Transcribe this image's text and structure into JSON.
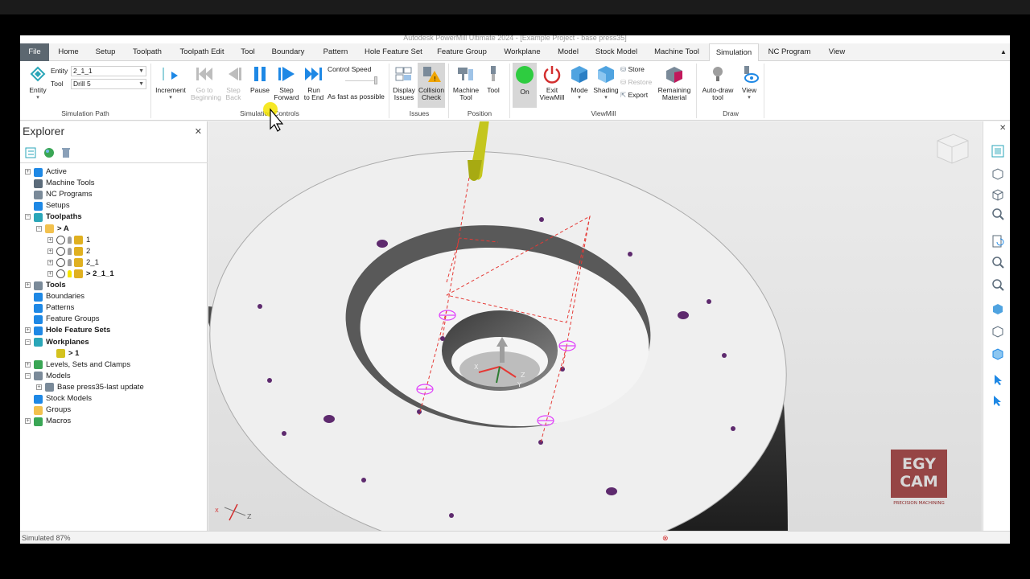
{
  "window": {
    "title": "Autodesk PowerMill Ultimate 2024 - [Example Project - base press35]"
  },
  "tabs": [
    "File",
    "Home",
    "Setup",
    "Toolpath",
    "Toolpath Edit",
    "Tool",
    "Boundary",
    "Pattern",
    "Hole Feature Set",
    "Feature Group",
    "Workplane",
    "Model",
    "Stock Model",
    "Machine Tool",
    "Simulation",
    "NC Program",
    "View"
  ],
  "active_tab": "Simulation",
  "ribbon": {
    "simpath": {
      "entity_btn": "Entity",
      "entity_label": "Entity",
      "entity_value": "2_1_1",
      "tool_label": "Tool",
      "tool_value": "Drill 5",
      "group": "Simulation Path"
    },
    "controls": {
      "increment": "Increment",
      "go_to_beginning_1": "Go to",
      "go_to_beginning_2": "Beginning",
      "step_back_1": "Step",
      "step_back_2": "Back",
      "pause": "Pause",
      "step_forward_1": "Step",
      "step_forward_2": "Forward",
      "run_to_end_1": "Run",
      "run_to_end_2": "to End",
      "control_speed": "Control Speed",
      "fast": "As fast as possible",
      "group": "Simulation Controls"
    },
    "issues": {
      "display_1": "Display",
      "display_2": "Issues",
      "collision_1": "Collision",
      "collision_2": "Check",
      "group": "Issues"
    },
    "position": {
      "machine_1": "Machine",
      "machine_2": "Tool",
      "tool": "Tool",
      "group": "Position"
    },
    "viewmill": {
      "on": "On",
      "exit_1": "Exit",
      "exit_2": "ViewMill",
      "mode": "Mode",
      "shading": "Shading",
      "store": "Store",
      "restore": "Restore",
      "export": "Export",
      "remaining_1": "Remaining",
      "remaining_2": "Material",
      "group": "ViewMill"
    },
    "draw": {
      "auto_1": "Auto-draw",
      "auto_2": "tool",
      "view": "View",
      "group": "Draw"
    }
  },
  "explorer": {
    "title": "Explorer",
    "tree": [
      {
        "label": "Active",
        "bold": false
      },
      {
        "label": "Machine Tools",
        "bold": false
      },
      {
        "label": "NC Programs",
        "bold": false
      },
      {
        "label": "Setups",
        "bold": false
      },
      {
        "label": "Toolpaths",
        "bold": true
      },
      {
        "label": "> A",
        "bold": true
      },
      {
        "label": "1",
        "bold": false
      },
      {
        "label": "2",
        "bold": false
      },
      {
        "label": "2_1",
        "bold": false
      },
      {
        "label": "> 2_1_1",
        "bold": true
      },
      {
        "label": "Tools",
        "bold": true
      },
      {
        "label": "Boundaries",
        "bold": false
      },
      {
        "label": "Patterns",
        "bold": false
      },
      {
        "label": "Feature Groups",
        "bold": false
      },
      {
        "label": "Hole Feature Sets",
        "bold": true
      },
      {
        "label": "Workplanes",
        "bold": true
      },
      {
        "label": "> 1",
        "bold": true
      },
      {
        "label": "Levels, Sets and Clamps",
        "bold": false
      },
      {
        "label": "Models",
        "bold": false
      },
      {
        "label": "Base press35-last update",
        "bold": false
      },
      {
        "label": "Stock Models",
        "bold": false
      },
      {
        "label": "Groups",
        "bold": false
      },
      {
        "label": "Macros",
        "bold": false
      }
    ]
  },
  "viewport": {
    "axis_labels": {
      "x": "X",
      "y": "Y",
      "z": "Z"
    },
    "watermark_1": "EGY",
    "watermark_2": "CAM",
    "watermark_3": "PRECISION MACHINING"
  },
  "status": {
    "text": "Simulated 87%"
  },
  "colors": {
    "accent": "#1e88e5",
    "tool_yellow": "#c4c61e",
    "path_red": "#e53935",
    "hole_purple": "#5e2a6e",
    "on_green": "#2ecc40",
    "file_tab": "#5c6770"
  }
}
